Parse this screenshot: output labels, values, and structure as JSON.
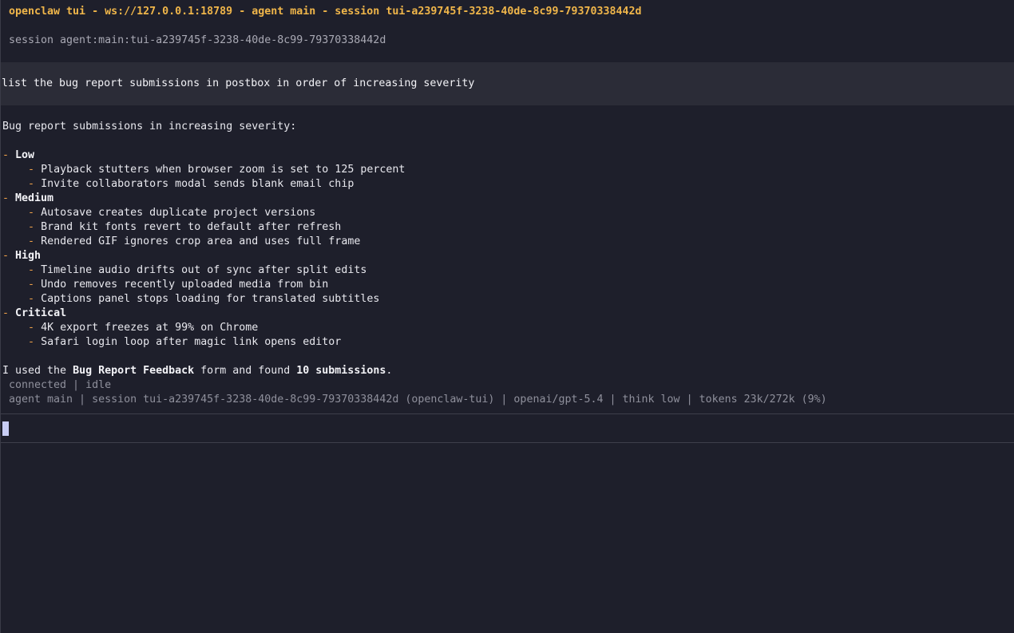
{
  "header": {
    "title": "openclaw tui - ws://127.0.0.1:18789 - agent main - session tui-a239745f-3238-40de-8c99-79370338442d",
    "session_label": "session agent:main:tui-a239745f-3238-40de-8c99-79370338442d"
  },
  "user_message": "list the bug report submissions in postbox in order of increasing severity",
  "reply": {
    "intro": "Bug report submissions in increasing severity:",
    "bullet_glyph": "-",
    "groups": [
      {
        "label": "Low",
        "items": [
          "Playback stutters when browser zoom is set to 125 percent",
          "Invite collaborators modal sends blank email chip"
        ]
      },
      {
        "label": "Medium",
        "items": [
          "Autosave creates duplicate project versions",
          "Brand kit fonts revert to default after refresh",
          "Rendered GIF ignores crop area and uses full frame"
        ]
      },
      {
        "label": "High",
        "items": [
          "Timeline audio drifts out of sync after split edits",
          "Undo removes recently uploaded media from bin",
          "Captions panel stops loading for translated subtitles"
        ]
      },
      {
        "label": "Critical",
        "items": [
          "4K export freezes at 99% on Chrome",
          "Safari login loop after magic link opens editor"
        ]
      }
    ],
    "summary_prefix": "I used the ",
    "summary_form": "Bug Report Feedback",
    "summary_middle": " form and found ",
    "summary_count": "10 submissions",
    "summary_suffix": "."
  },
  "status": {
    "connection": "connected | idle",
    "details": "agent main | session tui-a239745f-3238-40de-8c99-79370338442d (openclaw-tui) | openai/gpt-5.4 | think low | tokens 23k/272k (9%)"
  },
  "input": {
    "value": ""
  }
}
